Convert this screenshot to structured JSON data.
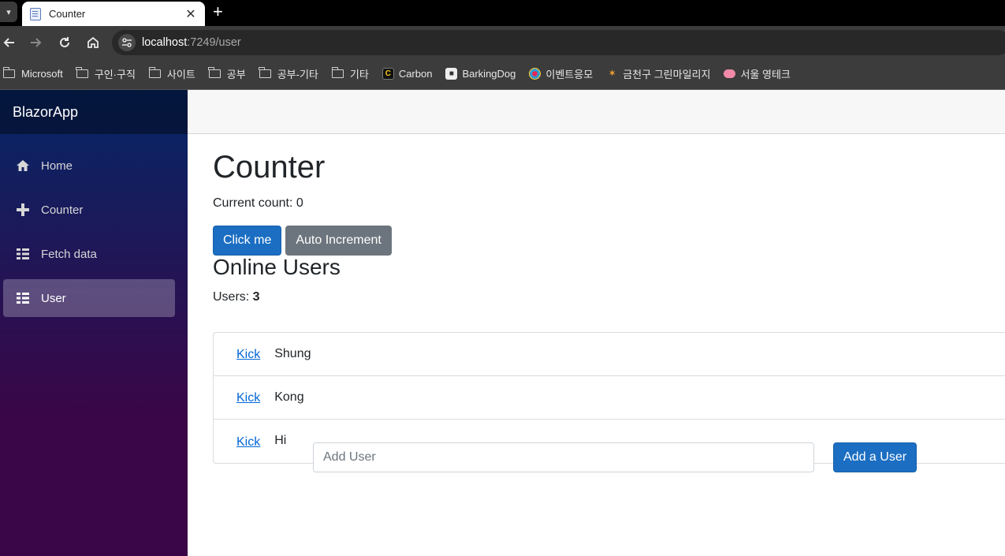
{
  "browser": {
    "tab": {
      "title": "Counter",
      "close": "✕"
    },
    "new_tab": "+",
    "url": {
      "host": "localhost",
      "rest": ":7249/user"
    },
    "bookmarks": [
      {
        "label": "Microsoft",
        "icon": "folder-icon"
      },
      {
        "label": "구인·구직",
        "icon": "folder-icon"
      },
      {
        "label": "사이트",
        "icon": "folder-icon"
      },
      {
        "label": "공부",
        "icon": "folder-icon"
      },
      {
        "label": "공부-기타",
        "icon": "folder-icon"
      },
      {
        "label": "기타",
        "icon": "folder-icon"
      },
      {
        "label": "Carbon",
        "icon": "carbon-icon"
      },
      {
        "label": "BarkingDog",
        "icon": "barkingdog-icon"
      },
      {
        "label": "이벤트응모",
        "icon": "event-icon"
      },
      {
        "label": "금천구 그린마일리지",
        "icon": "geumcheon-icon"
      },
      {
        "label": "서울 영테크",
        "icon": "seoul-icon"
      }
    ]
  },
  "app": {
    "brand": "BlazorApp",
    "nav": [
      {
        "label": "Home",
        "icon": "home-icon"
      },
      {
        "label": "Counter",
        "icon": "plus-icon"
      },
      {
        "label": "Fetch data",
        "icon": "list-icon"
      },
      {
        "label": "User",
        "icon": "list-icon",
        "active": true
      }
    ],
    "page": {
      "title": "Counter",
      "count_label": "Current count: 0",
      "click_button": "Click me",
      "auto_button": "Auto Increment",
      "online_title": "Online Users",
      "users_label": "Users: ",
      "users_count": "3",
      "users": [
        {
          "action": "Kick",
          "name": "Shung"
        },
        {
          "action": "Kick",
          "name": "Kong"
        },
        {
          "action": "Kick",
          "name": "Hi"
        }
      ],
      "add_placeholder": "Add User",
      "add_button": "Add a User"
    }
  },
  "colors": {
    "primary": "#1b6ec2",
    "secondary": "#6c757d",
    "link": "#0366d6",
    "sidebar_top": "#052767",
    "sidebar_bottom": "#3a0647"
  }
}
